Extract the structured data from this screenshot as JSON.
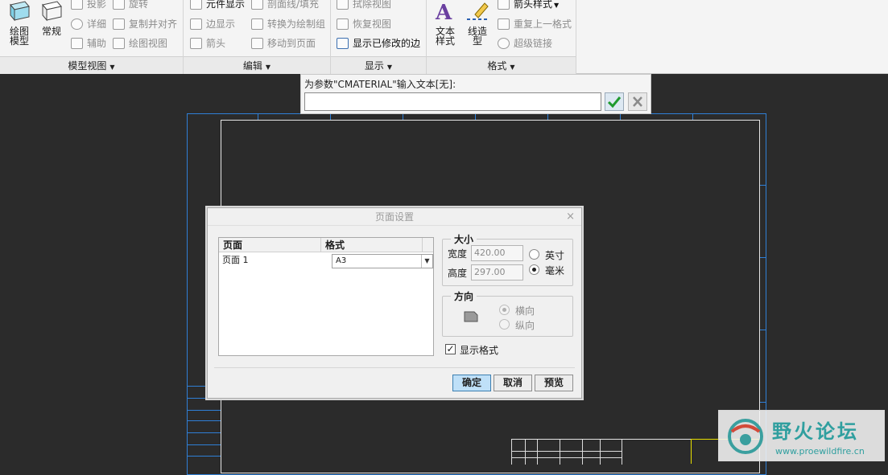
{
  "ribbon": {
    "model_views": {
      "label": "模型视图",
      "drawing_model": "绘图\n模型",
      "general": "常规",
      "projection": "投影",
      "rotate": "旋转",
      "detailed": "详细",
      "copy_align": "复制并对齐",
      "auxiliary": "辅助",
      "drawing_view": "绘图视图"
    },
    "edit": {
      "label": "编辑",
      "component_display": "元件显示",
      "xsection_fill": "剖面线/填充",
      "edge_display": "边显示",
      "convert_to_group": "转换为绘制组",
      "arrow": "箭头",
      "move_to_page": "移动到页面"
    },
    "display": {
      "label": "显示",
      "erase_view": "拭除视图",
      "restore_view": "恢复视图",
      "show_modified_edges": "显示已修改的边"
    },
    "format": {
      "label": "格式",
      "text_style": "文本\n样式",
      "line_style": "线造\n型",
      "arrow_style": "箭头样式",
      "repeat_format": "重复上一格式",
      "hyperlink": "超级链接"
    }
  },
  "prompt": {
    "label": "为参数\"CMATERIAL\"输入文本[无]:",
    "value": ""
  },
  "dialog": {
    "title": "页面设置",
    "close": "×",
    "table": {
      "headers": [
        "页面",
        "格式"
      ],
      "rows": [
        {
          "page": "页面 1",
          "format": "A3"
        }
      ]
    },
    "size": {
      "legend": "大小",
      "width_label": "宽度",
      "width_value": "420.00",
      "height_label": "高度",
      "height_value": "297.00",
      "units": [
        "英寸",
        "毫米"
      ],
      "selected_unit": "毫米"
    },
    "orientation": {
      "legend": "方向",
      "options": [
        "横向",
        "纵向"
      ],
      "selected": "横向"
    },
    "show_format": {
      "label": "显示格式",
      "checked": true
    },
    "buttons": {
      "ok": "确定",
      "cancel": "取消",
      "preview": "预览"
    }
  },
  "watermark": {
    "title": "野火论坛",
    "url": "www.proewildfire.cn"
  },
  "colors": {
    "canvas": "#2b2b2b",
    "frame": "#2f7fd6",
    "drawing_text": "#28d428",
    "highlight": "#e8e000"
  }
}
